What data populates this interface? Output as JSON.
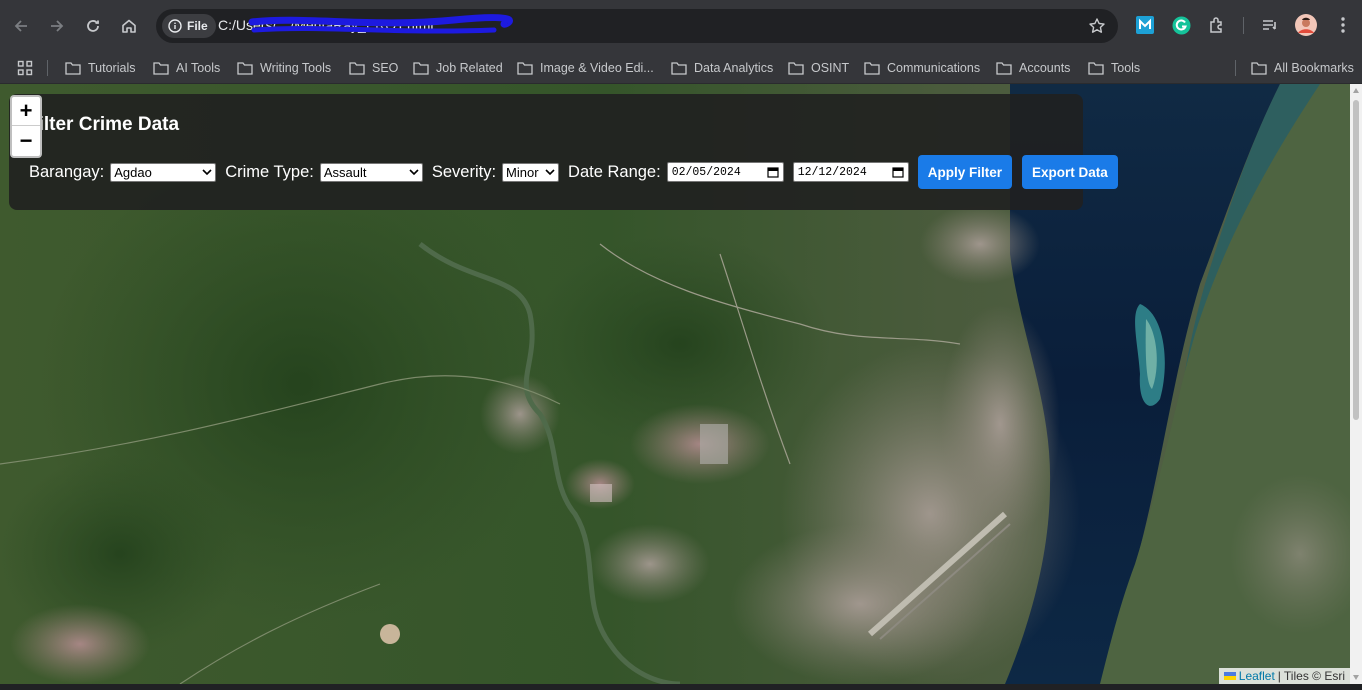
{
  "browser": {
    "site_chip": "File",
    "url": "C:/Users/…/MentaRay_PROT.html",
    "bookmarks": [
      "Tutorials",
      "AI Tools",
      "Writing Tools",
      "SEO",
      "Job Related",
      "Image & Video Edi...",
      "Data Analytics",
      "OSINT",
      "Communications",
      "Accounts",
      "Tools"
    ],
    "all_bookmarks": "All Bookmarks"
  },
  "filter": {
    "title": "Filter Crime Data",
    "barangay_label": "Barangay:",
    "barangay_value": "Agdao",
    "crime_type_label": "Crime Type:",
    "crime_type_value": "Assault",
    "severity_label": "Severity:",
    "severity_value": "Minor",
    "date_range_label": "Date Range:",
    "date_from": "02/05/2024",
    "date_to": "12/12/2024",
    "apply_button": "Apply Filter",
    "export_button": "Export Data"
  },
  "map": {
    "zoom_in": "+",
    "zoom_out": "−",
    "attribution_leaflet": "Leaflet",
    "attribution_separator": "|",
    "attribution_tiles": "Tiles © Esri"
  },
  "colors": {
    "accent": "#1a7be8",
    "panel_bg": "#202020",
    "chrome_bg": "#35363a"
  }
}
